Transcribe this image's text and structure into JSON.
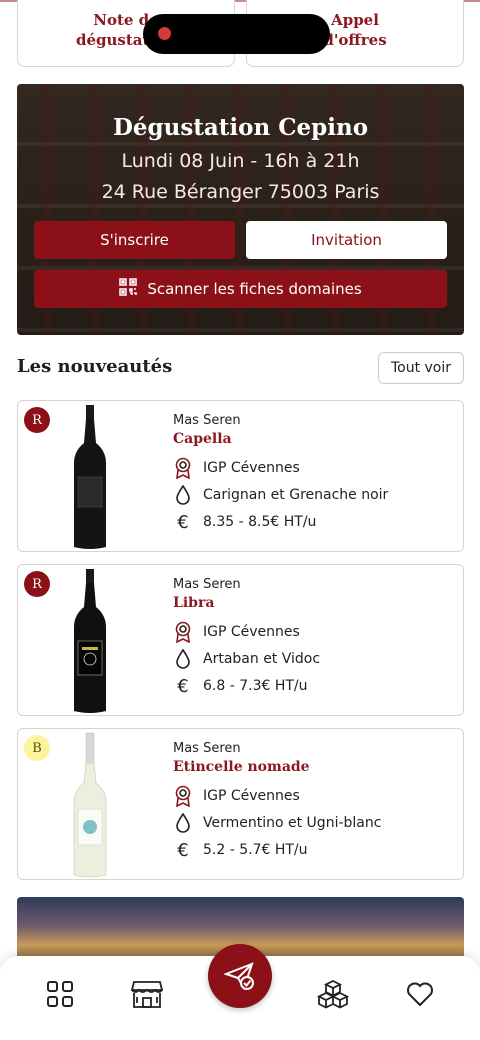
{
  "quick_links": [
    {
      "label": "Note de\ndégustation"
    },
    {
      "label": "Appel\nd'offres"
    }
  ],
  "event": {
    "title": "Dégustation Cepino",
    "date": "Lundi 08 Juin - 16h à 21h",
    "address": "24 Rue Béranger 75003 Paris",
    "register_label": "S'inscrire",
    "invite_label": "Invitation",
    "scan_label": "Scanner les fiches domaines"
  },
  "new_arrivals": {
    "title": "Les nouveautés",
    "see_all_label": "Tout voir",
    "wines": [
      {
        "badge": "R",
        "badge_color": "#8b1018",
        "producer": "Mas Seren",
        "name": "Capella",
        "appellation": "IGP Cévennes",
        "grapes": "Carignan et Grenache noir",
        "price": "8.35 - 8.5€ HT/u"
      },
      {
        "badge": "R",
        "badge_color": "#8b1018",
        "producer": "Mas Seren",
        "name": "Libra",
        "appellation": "IGP Cévennes",
        "grapes": "Artaban et Vidoc",
        "price": "6.8 - 7.3€ HT/u"
      },
      {
        "badge": "B",
        "badge_color": "#fbf49a",
        "producer": "Mas Seren",
        "name": "Etincelle nomade",
        "appellation": "IGP Cévennes",
        "grapes": "Vermentino et Ugni-blanc",
        "price": "5.2 - 5.7€ HT/u"
      }
    ]
  },
  "icons": {
    "euro": "€",
    "nav": [
      "grid-icon",
      "shop-icon",
      "send-icon",
      "boxes-icon",
      "heart-icon"
    ]
  },
  "colors": {
    "accent": "#8b1018",
    "white_wine_badge": "#fbf49a"
  }
}
